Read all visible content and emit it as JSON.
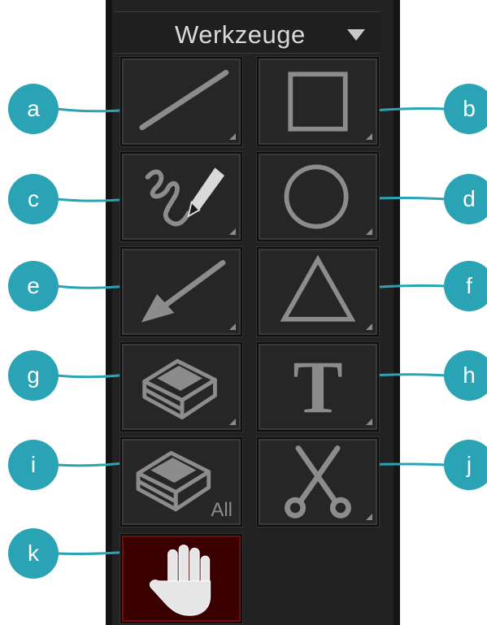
{
  "header": {
    "title": "Werkzeuge"
  },
  "tools": [
    {
      "callout": "a",
      "icon": "line-icon"
    },
    {
      "callout": "b",
      "icon": "rectangle-icon"
    },
    {
      "callout": "c",
      "icon": "freehand-pen-icon"
    },
    {
      "callout": "d",
      "icon": "circle-icon"
    },
    {
      "callout": "e",
      "icon": "arrow-icon"
    },
    {
      "callout": "f",
      "icon": "triangle-icon"
    },
    {
      "callout": "g",
      "icon": "eraser-icon"
    },
    {
      "callout": "h",
      "icon": "text-icon",
      "glyph": "T"
    },
    {
      "callout": "i",
      "icon": "eraser-all-icon",
      "label": "All"
    },
    {
      "callout": "j",
      "icon": "scissors-icon"
    },
    {
      "callout": "k",
      "icon": "hand-icon"
    }
  ],
  "colors": {
    "callout": "#2aa4b4",
    "panel": "#222222",
    "active_tool": "#3a0000",
    "icon": "#8c8c8c"
  }
}
